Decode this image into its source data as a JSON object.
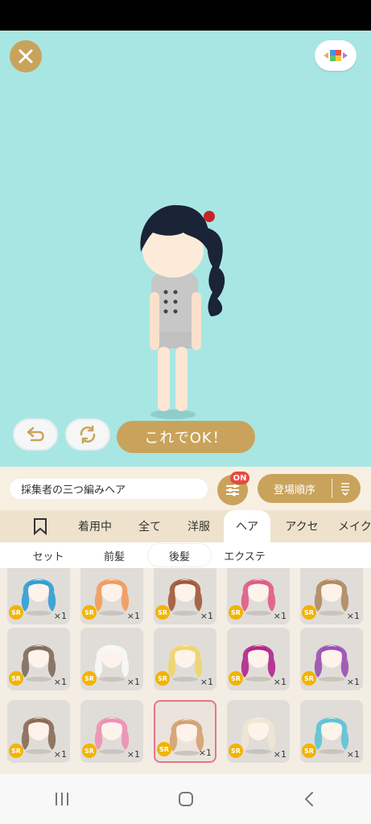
{
  "topbar": {
    "close_icon": "close-icon",
    "palette_icon": "color-palette-icon"
  },
  "stage": {
    "undo_icon": "undo-arrow-icon",
    "rotate_icon": "rotate-icon",
    "ok_label": "これでOK！"
  },
  "toolbar": {
    "item_name": "採集者の三つ編みヘア",
    "filter_badge": "ON",
    "sort_label": "登場順序"
  },
  "tabs": [
    "着用中",
    "全て",
    "洋服",
    "ヘア",
    "アクセ",
    "メイク"
  ],
  "active_tab": "ヘア",
  "subtabs": [
    "セット",
    "前髪",
    "後髪",
    "エクステ"
  ],
  "active_subtab": "後髪",
  "items": [
    {
      "rarity": "SR",
      "count": "×1",
      "hair_color": "#2f9ed6"
    },
    {
      "rarity": "SR",
      "count": "×1",
      "hair_color": "#f39a5c"
    },
    {
      "rarity": "SR",
      "count": "×1",
      "hair_color": "#a2583a"
    },
    {
      "rarity": "SR",
      "count": "×1",
      "hair_color": "#e05b86"
    },
    {
      "rarity": "SR",
      "count": "×1",
      "hair_color": "#b08a62"
    },
    {
      "rarity": "SR",
      "count": "×1",
      "hair_color": "#7f6b5c"
    },
    {
      "rarity": "SR",
      "count": "×1",
      "hair_color": "#f8f8f8"
    },
    {
      "rarity": "SR",
      "count": "×1",
      "hair_color": "#f0d56a"
    },
    {
      "rarity": "SR",
      "count": "×1",
      "hair_color": "#b1268c"
    },
    {
      "rarity": "SR",
      "count": "×1",
      "hair_color": "#9b4fb2"
    },
    {
      "rarity": "SR",
      "count": "×1",
      "hair_color": "#8a6a55"
    },
    {
      "rarity": "SR",
      "count": "×1",
      "hair_color": "#ee8fb5"
    },
    {
      "rarity": "SR",
      "count": "×1",
      "hair_color": "#d6a070"
    },
    {
      "rarity": "SR",
      "count": "×1",
      "hair_color": "#f1e6d4"
    },
    {
      "rarity": "SR",
      "count": "×1",
      "hair_color": "#5cc3d6"
    }
  ],
  "selected_item_index": 12,
  "navbar": {
    "recents_icon": "recents-icon",
    "home_icon": "home-icon",
    "back_icon": "back-icon"
  },
  "colors": {
    "stage_bg": "#a8e6e4",
    "accent_gold": "#c9a35b",
    "badge_red": "#e44a3f"
  }
}
